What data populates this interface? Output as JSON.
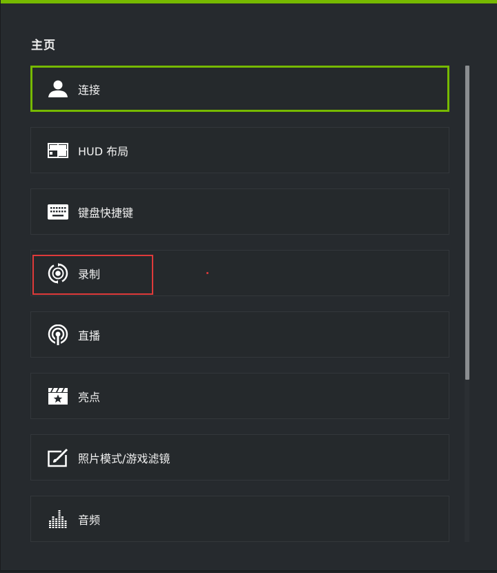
{
  "page": {
    "title": "主页",
    "accent_color": "#76b900",
    "highlight_color": "#e03a3a"
  },
  "menu": {
    "items": [
      {
        "label": "连接",
        "icon": "user-icon",
        "selected": true
      },
      {
        "label": "HUD 布局",
        "icon": "layout-icon",
        "selected": false
      },
      {
        "label": "键盘快捷键",
        "icon": "keyboard-icon",
        "selected": false
      },
      {
        "label": "录制",
        "icon": "record-icon",
        "selected": false
      },
      {
        "label": "直播",
        "icon": "broadcast-icon",
        "selected": false
      },
      {
        "label": "亮点",
        "icon": "highlights-icon",
        "selected": false
      },
      {
        "label": "照片模式/游戏滤镜",
        "icon": "photo-mode-icon",
        "selected": false
      },
      {
        "label": "音频",
        "icon": "audio-icon",
        "selected": false
      }
    ]
  }
}
